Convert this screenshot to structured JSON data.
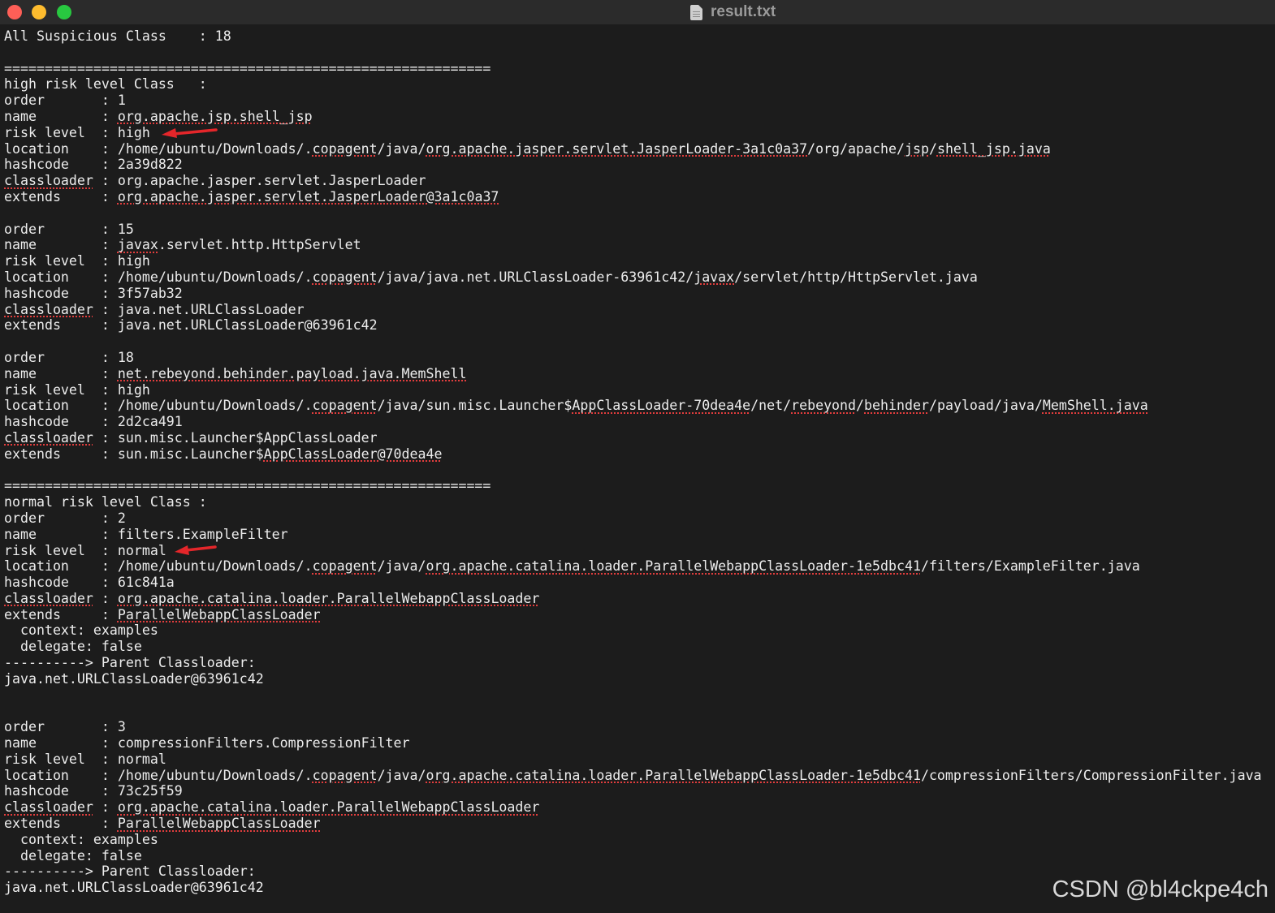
{
  "window": {
    "title": "result.txt",
    "title_icon": "document-icon",
    "traffic_lights": {
      "close": "#fe5f57",
      "minimize": "#febc2e",
      "zoom": "#28c840"
    }
  },
  "colors": {
    "background": "#1c1c1c",
    "text": "#ededed",
    "spell_underline": "#e23d3d",
    "arrow": "#e4262a"
  },
  "lines": [
    "All Suspicious Class    : 18",
    "",
    "============================================================",
    "high risk level Class   :",
    "order       : 1",
    "name        : org.apache.jsp.shell_jsp",
    "risk level  : high",
    "location    : /home/ubuntu/Downloads/.copagent/java/org.apache.jasper.servlet.JasperLoader-3a1c0a37/org/apache/jsp/shell_jsp.java",
    "hashcode    : 2a39d822",
    "classloader : org.apache.jasper.servlet.JasperLoader",
    "extends     : org.apache.jasper.servlet.JasperLoader@3a1c0a37",
    "",
    "order       : 15",
    "name        : javax.servlet.http.HttpServlet",
    "risk level  : high",
    "location    : /home/ubuntu/Downloads/.copagent/java/java.net.URLClassLoader-63961c42/javax/servlet/http/HttpServlet.java",
    "hashcode    : 3f57ab32",
    "classloader : java.net.URLClassLoader",
    "extends     : java.net.URLClassLoader@63961c42",
    "",
    "order       : 18",
    "name        : net.rebeyond.behinder.payload.java.MemShell",
    "risk level  : high",
    "location    : /home/ubuntu/Downloads/.copagent/java/sun.misc.Launcher$AppClassLoader-70dea4e/net/rebeyond/behinder/payload/java/MemShell.java",
    "hashcode    : 2d2ca491",
    "classloader : sun.misc.Launcher$AppClassLoader",
    "extends     : sun.misc.Launcher$AppClassLoader@70dea4e",
    "",
    "============================================================",
    "normal risk level Class :",
    "order       : 2",
    "name        : filters.ExampleFilter",
    "risk level  : normal",
    "location    : /home/ubuntu/Downloads/.copagent/java/org.apache.catalina.loader.ParallelWebappClassLoader-1e5dbc41/filters/ExampleFilter.java",
    "hashcode    : 61c841a",
    "classloader : org.apache.catalina.loader.ParallelWebappClassLoader",
    "extends     : ParallelWebappClassLoader",
    "  context: examples",
    "  delegate: false",
    "----------> Parent Classloader:",
    "java.net.URLClassLoader@63961c42",
    "",
    "",
    "order       : 3",
    "name        : compressionFilters.CompressionFilter",
    "risk level  : normal",
    "location    : /home/ubuntu/Downloads/.copagent/java/org.apache.catalina.loader.ParallelWebappClassLoader-1e5dbc41/compressionFilters/CompressionFilter.java",
    "hashcode    : 73c25f59",
    "classloader : org.apache.catalina.loader.ParallelWebappClassLoader",
    "extends     : ParallelWebappClassLoader",
    "  context: examples",
    "  delegate: false",
    "----------> Parent Classloader:",
    "java.net.URLClassLoader@63961c42"
  ],
  "misspelled_words": [
    "org.apache.jsp.shell_jsp",
    "copagent",
    "org.apache.jasper.servlet.JasperLoader-3a1c0a37",
    "jsp",
    "shell_jsp.java",
    "org.apache.jasper.servlet.JasperLoader@3a1c0a37",
    "javax",
    "net.rebeyond.behinder.payload.java.MemShell",
    "AppClassLoader-70dea4e",
    "rebeyond",
    "behinder",
    "MemShell.java",
    "classloader",
    "AppClassLoader@70dea4e",
    "org.apache.catalina.loader.ParallelWebappClassLoader-1e5dbc41",
    "org.apache.catalina.loader.ParallelWebappClassLoader",
    "ParallelWebappClassLoader"
  ],
  "annotations": [
    {
      "icon": "red-arrow-icon",
      "points_to": "high"
    },
    {
      "icon": "red-arrow-icon",
      "points_to": "normal"
    }
  ],
  "watermark": "CSDN @bl4ckpe4ch"
}
